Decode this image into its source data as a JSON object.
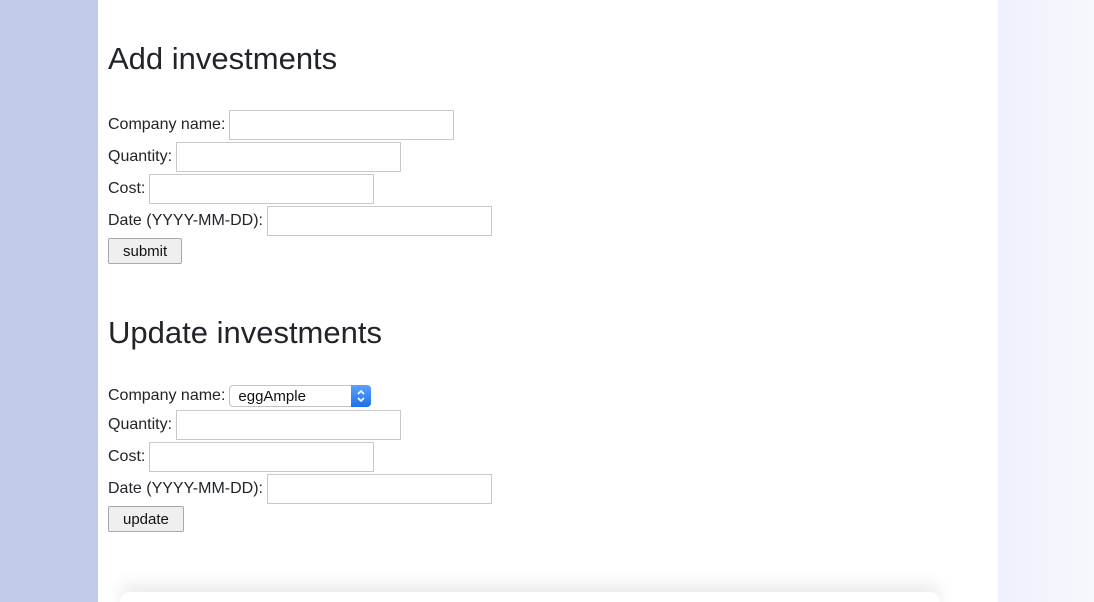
{
  "add": {
    "title": "Add investments",
    "company_label": "Company name:",
    "quantity_label": "Quantity:",
    "cost_label": "Cost:",
    "date_label": "Date (YYYY-MM-DD):",
    "company_value": "",
    "quantity_value": "",
    "cost_value": "",
    "date_value": "",
    "submit_label": "submit"
  },
  "update": {
    "title": "Update investments",
    "company_label": "Company name:",
    "company_selected": "eggAmple",
    "quantity_label": "Quantity:",
    "cost_label": "Cost:",
    "date_label": "Date (YYYY-MM-DD):",
    "quantity_value": "",
    "cost_value": "",
    "date_value": "",
    "update_label": "update"
  },
  "icons": {
    "select_arrow": "chevron-up-down-icon"
  },
  "colors": {
    "left_background": "#c3cbeb",
    "panel_background": "#ffffff",
    "right_background": "#eef0fb",
    "select_accent": "#1f6fe8"
  }
}
